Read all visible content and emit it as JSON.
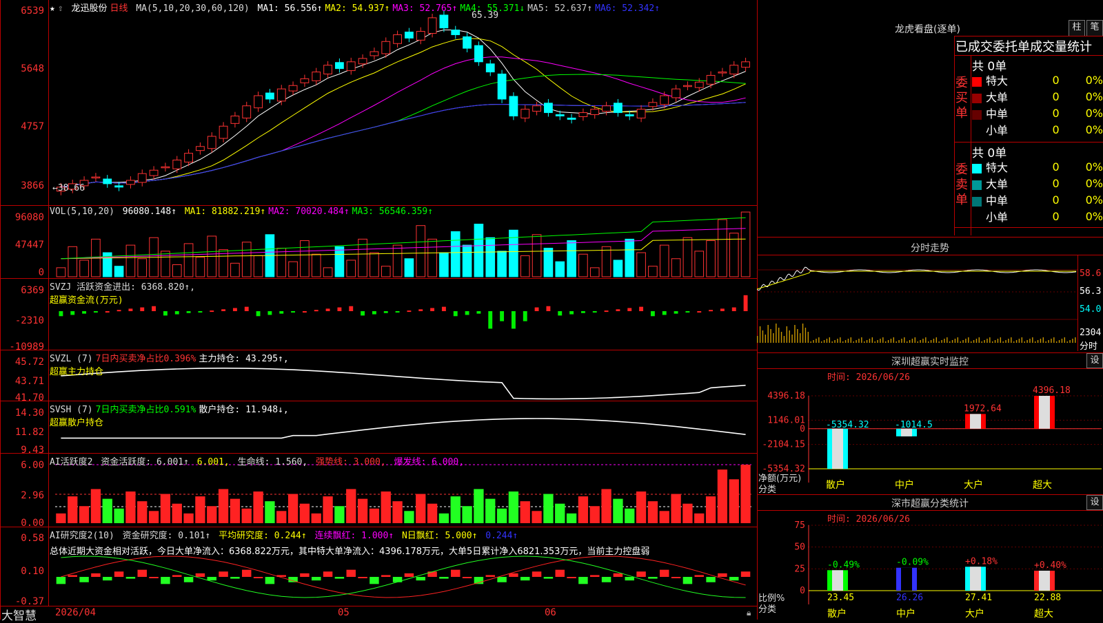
{
  "stock": {
    "name": "龙迅股份",
    "period": "日线"
  },
  "ma_legend": {
    "label": "MA(5,10,20,30,60,120)",
    "items": [
      {
        "text": "MA1: 56.556↑",
        "color": "#ffffff"
      },
      {
        "text": "MA2: 54.937↑",
        "color": "#ffff00"
      },
      {
        "text": "MA3: 52.765↑",
        "color": "#ff00ff"
      },
      {
        "text": "MA4: 55.371↓",
        "color": "#00ff00"
      },
      {
        "text": "MA5: 52.637↑",
        "color": "#cccccc"
      },
      {
        "text": "MA6: 52.342↑",
        "color": "#3333ff"
      }
    ]
  },
  "price_axis": [
    "6539",
    "5648",
    "4757",
    "3866"
  ],
  "price_marks": {
    "high": "65.39",
    "low": "←38.66"
  },
  "vol_legend": {
    "label": "VOL(5,10,20)",
    "value": "96080.148↑",
    "items": [
      {
        "text": "MA1: 81882.219↑",
        "color": "#ffff00"
      },
      {
        "text": "MA2: 70020.484↑",
        "color": "#ff00ff"
      },
      {
        "text": "MA3: 56546.359↑",
        "color": "#00ff00"
      }
    ]
  },
  "vol_axis": [
    "96080",
    "47447",
    "0"
  ],
  "svzj": {
    "line1": "SVZJ  活跃资金进出: 6368.820↑,",
    "line2": "超赢资金流(万元)",
    "axis": [
      "6369",
      "-2310",
      "-10989"
    ]
  },
  "svzl": {
    "prefix": "SVZL  (7)",
    "ratio": "7日内买卖净占比0.396%",
    "hold": "主力持仓: 43.295↑,",
    "title": "超赢主力持仓",
    "axis": [
      "45.72",
      "43.71",
      "41.70"
    ]
  },
  "svsh": {
    "prefix": "SVSH  (7)",
    "ratio": "7日内买卖净占比0.591%",
    "hold": "散户持仓: 11.948↓,",
    "title": "超赢散户持仓",
    "axis": [
      "14.30",
      "11.82",
      "9.43"
    ]
  },
  "ai1": {
    "prefix": "AI活跃度2",
    "a": "资金活跃度: 6.001↑",
    "b": "6.001,",
    "c": "生命线: 1.560,",
    "d": "强势线: 3.000,",
    "e": "爆发线: 6.000,",
    "axis": [
      "6.00",
      "2.96",
      "0.00"
    ]
  },
  "ai2": {
    "prefix": "AI研究度2(10)",
    "a": "资金研究度: 0.101↑",
    "b": "平均研究度: 0.244↑",
    "c": "连续飘红: 1.000↑",
    "d": "N日飘红: 5.000↑",
    "e": "0.244↑",
    "summary": "总体近期大资金相对活跃，今日大单净流入：6368.822万元，其中特大单净流入：4396.178万元，大单5日累计净入6821.353万元，当前主力控盘弱",
    "axis": [
      "0.58",
      "0.10",
      "-0.37"
    ]
  },
  "xaxis": {
    "labels": [
      "2026/04",
      "05",
      "06"
    ]
  },
  "brand": "大智慧",
  "dragon": {
    "title": "龙虎看盘(逐单)",
    "btn_a": "柱",
    "btn_b": "笔",
    "subtitle": "已成交委托单成交量统计",
    "buy_label": "委买单",
    "sell_label": "委卖单",
    "buy_total": "共 0单",
    "sell_total": "共 0单",
    "buy_rows": [
      {
        "name": "特大",
        "v": "0",
        "p": "0%",
        "color": "#ff0000"
      },
      {
        "name": "大单",
        "v": "0",
        "p": "0%",
        "color": "#990000"
      },
      {
        "name": "中单",
        "v": "0",
        "p": "0%",
        "color": "#660000"
      },
      {
        "name": "小单",
        "v": "0",
        "p": "0%",
        "color": "#000000"
      }
    ],
    "sell_rows": [
      {
        "name": "特大",
        "v": "0",
        "p": "0%",
        "color": "#00ffff"
      },
      {
        "name": "大单",
        "v": "0",
        "p": "0%",
        "color": "#009999"
      },
      {
        "name": "中单",
        "v": "0",
        "p": "0%",
        "color": "#007777"
      },
      {
        "name": "小单",
        "v": "0",
        "p": "0%",
        "color": "#000000"
      }
    ]
  },
  "intraday": {
    "title": "分时走势",
    "axis": [
      "58.6",
      "56.3",
      "54.0"
    ],
    "vol": "2304",
    "vol_label": "分时"
  },
  "sz_monitor": {
    "title": "深圳超赢实时监控",
    "btn": "设",
    "date": "时间: 2026/06/26",
    "axis": [
      "4396.18",
      "1146.01",
      "0",
      "-2104.15",
      "-5354.32"
    ],
    "ylabel1": "净额(万元)",
    "ylabel2": "分类",
    "bars": [
      {
        "cat": "散户",
        "value": -5354.32,
        "label": "-5354.32"
      },
      {
        "cat": "中户",
        "value": -1014.5,
        "label": "-1014.5"
      },
      {
        "cat": "大户",
        "value": 1972.64,
        "label": "1972.64"
      },
      {
        "cat": "超大",
        "value": 4396.18,
        "label": "4396.18"
      }
    ]
  },
  "sz_class": {
    "title": "深市超赢分类统计",
    "btn": "设",
    "date": "时间: 2026/06/26",
    "axis": [
      "75",
      "50",
      "25",
      "0"
    ],
    "ylabel1": "比例%",
    "ylabel2": "分类",
    "bars": [
      {
        "cat": "散户",
        "value": 23.45,
        "label": "23.45",
        "delta": "-0.49%"
      },
      {
        "cat": "中户",
        "value": 26.26,
        "label": "26.26",
        "delta": "-0.09%"
      },
      {
        "cat": "大户",
        "value": 27.41,
        "label": "27.41",
        "delta": "+0.18%"
      },
      {
        "cat": "超大",
        "value": 22.88,
        "label": "22.88",
        "delta": "+0.40%"
      }
    ]
  },
  "chart_data": [
    {
      "type": "candlestick",
      "title": "龙迅股份 日线",
      "ylim": [
        38.66,
        65.39
      ],
      "x": [
        "2026/04",
        "05",
        "06"
      ],
      "series": [
        {
          "name": "MA1",
          "value": 56.556
        },
        {
          "name": "MA2",
          "value": 54.937
        },
        {
          "name": "MA3",
          "value": 52.765
        },
        {
          "name": "MA4",
          "value": 55.371
        },
        {
          "name": "MA5",
          "value": 52.637
        },
        {
          "name": "MA6",
          "value": 52.342
        }
      ],
      "close_approx": [
        40.0,
        40.5,
        41.0,
        41.5,
        40.5,
        40.0,
        41.0,
        42.0,
        42.5,
        43.0,
        44.0,
        45.0,
        46.0,
        47.5,
        49.0,
        50.5,
        52.0,
        53.5,
        53.0,
        54.5,
        55.0,
        56.0,
        57.0,
        58.0,
        57.5,
        58.5,
        59.0,
        60.0,
        61.5,
        62.5,
        62.0,
        63.0,
        65.0,
        63.5,
        62.5,
        60.5,
        58.5,
        57.0,
        53.0,
        50.5,
        51.5,
        52.0,
        51.0,
        50.5,
        50.0,
        51.0,
        51.5,
        52.0,
        51.0,
        50.5,
        51.5,
        52.5,
        53.5,
        54.5,
        55.0,
        55.5,
        56.5,
        57.0,
        58.0,
        58.5
      ]
    },
    {
      "type": "bar",
      "title": "VOL",
      "ylim": [
        0,
        96080
      ],
      "series": [
        {
          "name": "VOL",
          "last": 96080.148
        },
        {
          "name": "MA1",
          "value": 81882.219
        },
        {
          "name": "MA2",
          "value": 70020.484
        },
        {
          "name": "MA3",
          "value": 56546.359
        }
      ]
    },
    {
      "type": "bar",
      "title": "超赢资金流(万元)",
      "ylim": [
        -10989,
        6369
      ],
      "last": 6368.82
    },
    {
      "type": "line",
      "title": "超赢主力持仓",
      "ylim": [
        41.7,
        45.72
      ],
      "last": 43.295
    },
    {
      "type": "line",
      "title": "超赢散户持仓",
      "ylim": [
        9.43,
        14.3
      ],
      "last": 11.948
    },
    {
      "type": "bar",
      "title": "AI活跃度2",
      "ylim": [
        0,
        6.0
      ],
      "last": 6.001
    },
    {
      "type": "bar",
      "title": "AI研究度2(10)",
      "ylim": [
        -0.37,
        0.58
      ],
      "last": 0.101
    },
    {
      "type": "bar",
      "title": "深圳超赢实时监控",
      "categories": [
        "散户",
        "中户",
        "大户",
        "超大"
      ],
      "values": [
        -5354.32,
        -1014.5,
        1972.64,
        4396.18
      ],
      "ylim": [
        -5354.32,
        4396.18
      ]
    },
    {
      "type": "bar",
      "title": "深市超赢分类统计",
      "categories": [
        "散户",
        "中户",
        "大户",
        "超大"
      ],
      "values": [
        23.45,
        26.26,
        27.41,
        22.88
      ],
      "ylim": [
        0,
        75
      ]
    }
  ]
}
